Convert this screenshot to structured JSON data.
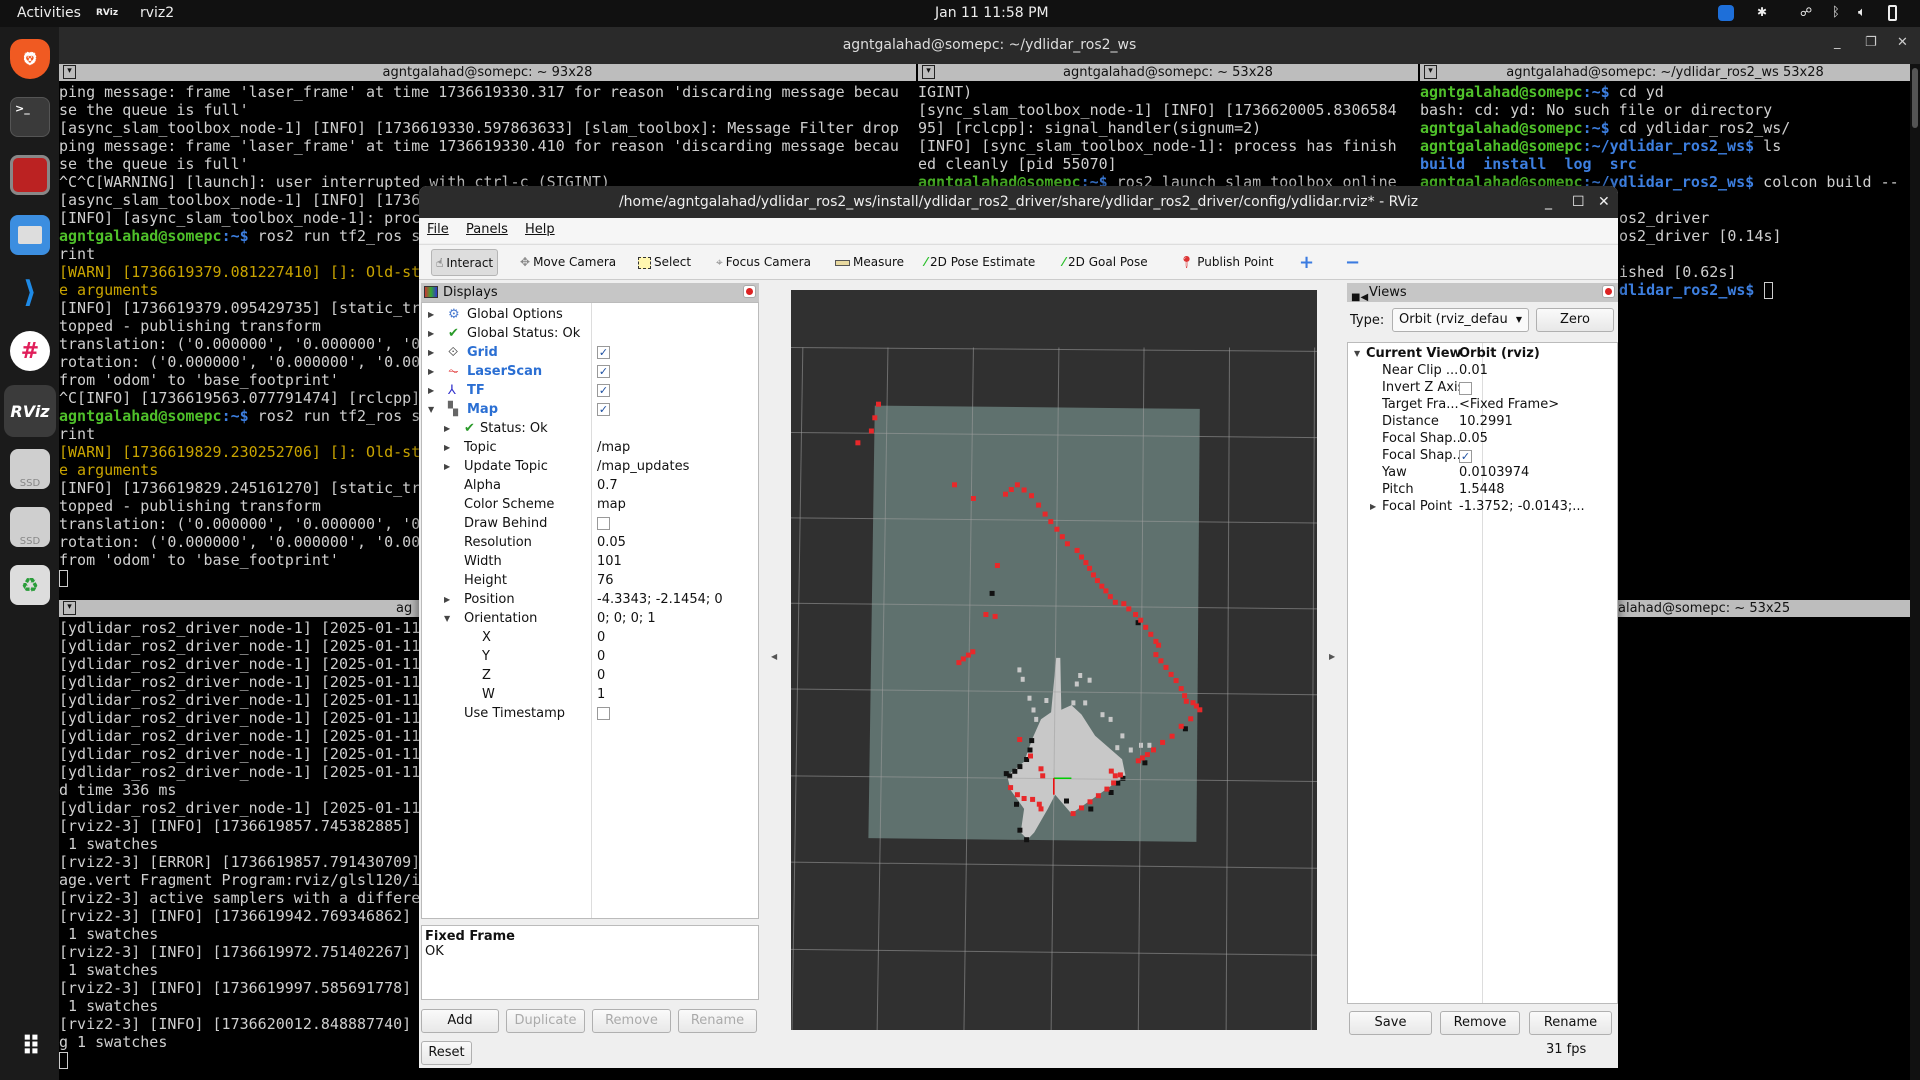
{
  "topbar": {
    "activities": "Activities",
    "app_name": "rviz2",
    "clock": "Jan 11  11:58 PM"
  },
  "dock": {
    "items": [
      {
        "name": "brave"
      },
      {
        "name": "terminal",
        "label": ">_"
      },
      {
        "name": "terminator"
      },
      {
        "name": "files"
      },
      {
        "name": "vscode"
      },
      {
        "name": "slack"
      },
      {
        "name": "rviz",
        "label": "RViz"
      },
      {
        "name": "ssd-drive",
        "label": "SSD"
      },
      {
        "name": "ssd-drive",
        "label": "SSD"
      },
      {
        "name": "trash"
      },
      {
        "name": "show-apps"
      }
    ]
  },
  "terminal_window": {
    "title": "agntgalahad@somepc: ~/ydlidar_ros2_ws",
    "panes": {
      "top_left": {
        "header": "agntgalahad@somepc: ~ 93x28",
        "lines": [
          {
            "t": "ping message: frame 'laser_frame' at time 1736619330.317 for reason 'discarding message becau"
          },
          {
            "t": "se the queue is full'"
          },
          {
            "t": "[async_slam_toolbox_node-1] [INFO] [1736619330.597863633] [slam_toolbox]: Message Filter drop"
          },
          {
            "t": "ping message: frame 'laser_frame' at time 1736619330.410 for reason 'discarding message becau"
          },
          {
            "t": "se the queue is full'"
          },
          {
            "t": "^C^C[WARNING] [launch]: user interrupted with ctrl-c (SIGINT)"
          },
          {
            "t": "[async_slam_toolbox_node-1] [INFO] [1736"
          },
          {
            "t": "[INFO] [async_slam_toolbox_node-1]: proc"
          },
          {
            "p": "agntgalahad@somepc",
            "d": ":~$",
            "t": " ros2 run tf2_ros s"
          },
          {
            "t": "rint"
          },
          {
            "t": "[WARN] [1736619379.081227410] []: Old-st",
            "c": "y"
          },
          {
            "t": "e arguments",
            "c": "y"
          },
          {
            "t": "[INFO] [1736619379.095429735] [static_tr"
          },
          {
            "t": "topped - publishing transform"
          },
          {
            "t": "translation: ('0.000000', '0.000000', '0"
          },
          {
            "t": "rotation: ('0.000000', '0.000000', '0.00"
          },
          {
            "t": "from 'odom' to 'base_footprint'"
          },
          {
            "t": "^C[INFO] [1736619563.077791474] [rclcpp]"
          },
          {
            "p": "agntgalahad@somepc",
            "d": ":~$",
            "t": " ros2 run tf2_ros s"
          },
          {
            "t": "rint"
          },
          {
            "t": "[WARN] [1736619829.230252706] []: Old-st",
            "c": "y"
          },
          {
            "t": "e arguments",
            "c": "y"
          },
          {
            "t": "[INFO] [1736619829.245161270] [static_tr"
          },
          {
            "t": "topped - publishing transform"
          },
          {
            "t": "translation: ('0.000000', '0.000000', '0"
          },
          {
            "t": "rotation: ('0.000000', '0.000000', '0.00"
          },
          {
            "t": "from 'odom' to 'base_footprint'"
          },
          {
            "cursor": true
          }
        ]
      },
      "top_middle": {
        "header": "agntgalahad@somepc: ~ 53x28",
        "lines": [
          {
            "t": "IGINT)"
          },
          {
            "t": "[sync_slam_toolbox_node-1] [INFO] [1736620005.8306584"
          },
          {
            "t": "95] [rclcpp]: signal_handler(signum=2)"
          },
          {
            "t": "[INFO] [sync_slam_toolbox_node-1]: process has finish"
          },
          {
            "t": "ed cleanly [pid 55070]"
          },
          {
            "p": "agntgalahad@somepc",
            "d": ":~$",
            "t": " ros2 launch slam_toolbox online"
          }
        ]
      },
      "top_right": {
        "header": "agntgalahad@somepc: ~/ydlidar_ros2_ws 53x28",
        "lines": [
          {
            "p": "agntgalahad@somepc",
            "d": ":~$",
            "t": " cd yd"
          },
          {
            "t": "bash: cd: yd: No such file or directory"
          },
          {
            "p": "agntgalahad@somepc",
            "d": ":~$",
            "t": " cd ydlidar_ros2_ws/"
          },
          {
            "p": "agntgalahad@somepc",
            "d": ":~/ydlidar_ros2_ws$",
            "t": " ls"
          },
          {
            "t": "build  install  log  src",
            "c": "b"
          },
          {
            "p": "agntgalahad@somepc",
            "d": ":~/ydlidar_ros2_ws$",
            "t": " colcon build --"
          },
          {
            "t": ""
          },
          {
            "t": "os2_driver",
            "off": true
          },
          {
            "t": "os2_driver [0.14s]",
            "off": true
          },
          {
            "t": ""
          },
          {
            "t": "ished [0.62s]",
            "off": true
          },
          {
            "d": "dlidar_ros2_ws$",
            "t": " ",
            "off": true,
            "cursor": true
          }
        ]
      },
      "bottom_left": {
        "header": "ag",
        "lines": [
          {
            "t": "[ydlidar_ros2_driver_node-1] [2025-01-11"
          },
          {
            "t": "[ydlidar_ros2_driver_node-1] [2025-01-11"
          },
          {
            "t": "[ydlidar_ros2_driver_node-1] [2025-01-11"
          },
          {
            "t": "[ydlidar_ros2_driver_node-1] [2025-01-11"
          },
          {
            "t": "[ydlidar_ros2_driver_node-1] [2025-01-11"
          },
          {
            "t": "[ydlidar_ros2_driver_node-1] [2025-01-11"
          },
          {
            "t": "[ydlidar_ros2_driver_node-1] [2025-01-11"
          },
          {
            "t": "[ydlidar_ros2_driver_node-1] [2025-01-11"
          },
          {
            "t": "[ydlidar_ros2_driver_node-1] [2025-01-11"
          },
          {
            "t": "d time 336 ms"
          },
          {
            "t": "[ydlidar_ros2_driver_node-1] [2025-01-11"
          },
          {
            "t": "[rviz2-3] [INFO] [1736619857.745382885]"
          },
          {
            "t": " 1 swatches"
          },
          {
            "t": "[rviz2-3] [ERROR] [1736619857.791430709]"
          },
          {
            "t": "age.vert Fragment Program:rviz/glsl120/i"
          },
          {
            "t": "[rviz2-3] active samplers with a differe"
          },
          {
            "t": "[rviz2-3] [INFO] [1736619942.769346862]"
          },
          {
            "t": " 1 swatches"
          },
          {
            "t": "[rviz2-3] [INFO] [1736619972.751402267]"
          },
          {
            "t": " 1 swatches"
          },
          {
            "t": "[rviz2-3] [INFO] [1736619997.585691778]"
          },
          {
            "t": " 1 swatches"
          },
          {
            "t": "[rviz2-3] [INFO] [1736620012.848887740]"
          },
          {
            "t": "g 1 swatches"
          },
          {
            "cursor": true
          }
        ]
      },
      "bottom_right": {
        "header": "alahad@somepc: ~ 53x25",
        "lines": []
      }
    }
  },
  "rviz": {
    "title": "/home/agntgalahad/ydlidar_ros2_ws/install/ydlidar_ros2_driver/share/ydlidar_ros2_driver/config/ydlidar.rviz* - RViz",
    "menu": [
      "File",
      "Panels",
      "Help"
    ],
    "toolbar": [
      {
        "label": "Interact",
        "icon": "hand-pointer-icon",
        "active": true
      },
      {
        "label": "Move Camera",
        "icon": "move-camera-icon"
      },
      {
        "label": "Select",
        "icon": "select-box-icon"
      },
      {
        "label": "Focus Camera",
        "icon": "focus-crosshair-icon"
      },
      {
        "label": "Measure",
        "icon": "ruler-icon"
      },
      {
        "label": "2D Pose Estimate",
        "icon": "green-arrow-icon"
      },
      {
        "label": "2D Goal Pose",
        "icon": "green-arrow-icon"
      },
      {
        "label": "Publish Point",
        "icon": "map-pin-icon"
      }
    ],
    "displays": {
      "title": "Displays",
      "rows": [
        {
          "label": "Global Options",
          "level": 0,
          "toggle": "collapsed",
          "icon": "gear-icon"
        },
        {
          "label": "Global Status: Ok",
          "level": 0,
          "toggle": "collapsed",
          "icon": "check-icon"
        },
        {
          "label": "Grid",
          "level": 0,
          "toggle": "collapsed",
          "icon": "grid-icon",
          "blue": true,
          "checked": true
        },
        {
          "label": "LaserScan",
          "level": 0,
          "toggle": "collapsed",
          "icon": "laserscan-icon",
          "blue": true,
          "checked": true
        },
        {
          "label": "TF",
          "level": 0,
          "toggle": "collapsed",
          "icon": "tf-axes-icon",
          "blue": true,
          "checked": true
        },
        {
          "label": "Map",
          "level": 0,
          "toggle": "expanded",
          "icon": "map-icon",
          "blue": true,
          "checked": true
        },
        {
          "label": "Status: Ok",
          "level": 1,
          "toggle": "collapsed",
          "icon": "check-icon"
        },
        {
          "label": "Topic",
          "level": 1,
          "toggle": "collapsed",
          "value": "/map"
        },
        {
          "label": "Update Topic",
          "level": 1,
          "toggle": "collapsed",
          "value": "/map_updates"
        },
        {
          "label": "Alpha",
          "level": 1,
          "value": "0.7"
        },
        {
          "label": "Color Scheme",
          "level": 1,
          "value": "map"
        },
        {
          "label": "Draw Behind",
          "level": 1,
          "checked": false
        },
        {
          "label": "Resolution",
          "level": 1,
          "value": "0.05"
        },
        {
          "label": "Width",
          "level": 1,
          "value": "101"
        },
        {
          "label": "Height",
          "level": 1,
          "value": "76"
        },
        {
          "label": "Position",
          "level": 1,
          "toggle": "collapsed",
          "value": "-4.3343; -2.1454; 0"
        },
        {
          "label": "Orientation",
          "level": 1,
          "toggle": "expanded",
          "value": "0; 0; 0; 1"
        },
        {
          "label": "X",
          "level": 2,
          "value": "0"
        },
        {
          "label": "Y",
          "level": 2,
          "value": "0"
        },
        {
          "label": "Z",
          "level": 2,
          "value": "0"
        },
        {
          "label": "W",
          "level": 2,
          "value": "1"
        },
        {
          "label": "Use Timestamp",
          "level": 1,
          "checked": false
        }
      ],
      "help_title": "Fixed Frame",
      "help_text": "OK",
      "buttons": {
        "add": "Add",
        "duplicate": "Duplicate",
        "remove": "Remove",
        "rename": "Rename",
        "reset": "Reset"
      }
    },
    "views": {
      "title": "Views",
      "type_label": "Type:",
      "type_value": "Orbit (rviz_defau",
      "zero": "Zero",
      "rows": [
        {
          "label": "Current View",
          "value": "Orbit (rviz)",
          "bold": true,
          "toggle": "expanded",
          "level": 0
        },
        {
          "label": "Near Clip ...",
          "value": "0.01",
          "level": 1
        },
        {
          "label": "Invert Z Axis",
          "checked": false,
          "level": 1
        },
        {
          "label": "Target Fra...",
          "value": "<Fixed Frame>",
          "level": 1
        },
        {
          "label": "Distance",
          "value": "10.2991",
          "level": 1
        },
        {
          "label": "Focal Shap...",
          "value": "0.05",
          "level": 1
        },
        {
          "label": "Focal Shap...",
          "checked": true,
          "level": 1
        },
        {
          "label": "Yaw",
          "value": "0.0103974",
          "level": 1
        },
        {
          "label": "Pitch",
          "value": "1.5448",
          "level": 1
        },
        {
          "label": "Focal Point",
          "value": "-1.3752; -0.0143;...",
          "toggle": "collapsed",
          "level": 1
        }
      ],
      "buttons": {
        "save": "Save",
        "remove": "Remove",
        "rename": "Rename"
      }
    },
    "fps": "31 fps",
    "colors": {
      "laser": "#e8282a",
      "map_unknown": "#5f716e",
      "map_free": "#c8c8c8",
      "background": "#303030",
      "grid": "#a0a0a0"
    }
  }
}
